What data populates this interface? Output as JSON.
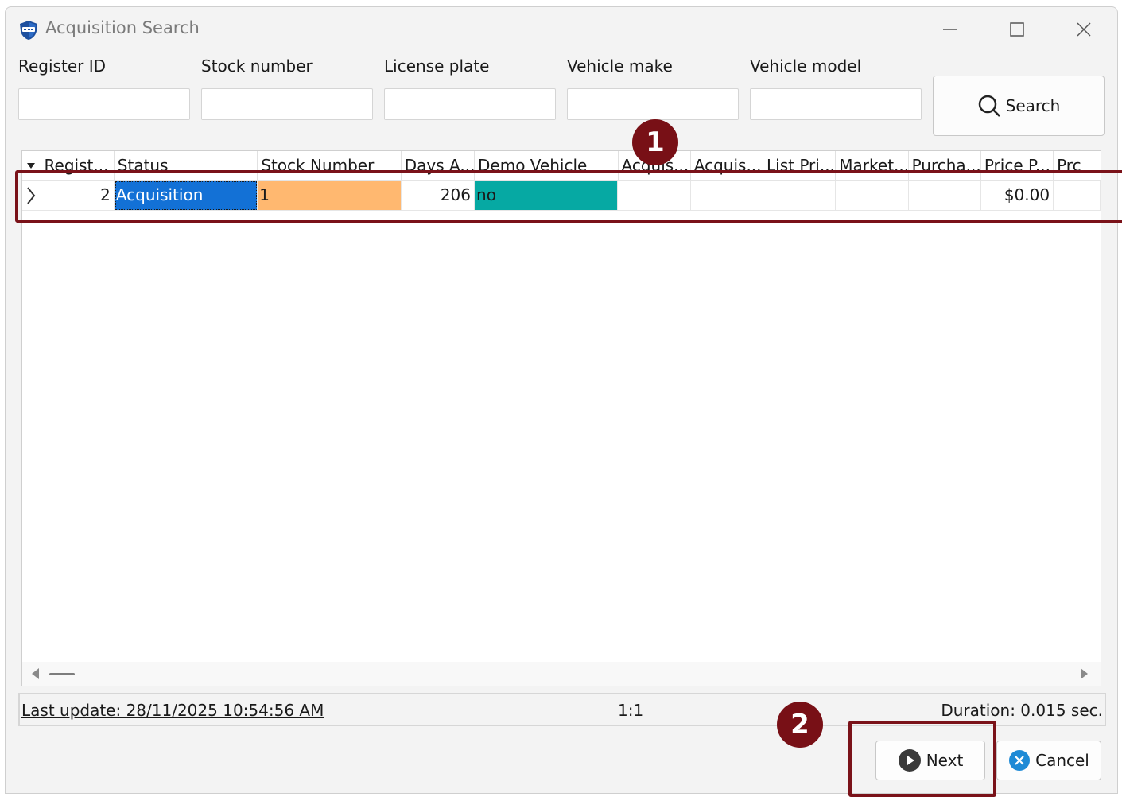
{
  "window": {
    "title": "Acquisition Search"
  },
  "filters": [
    {
      "label": "Register ID",
      "value": ""
    },
    {
      "label": "Stock number",
      "value": ""
    },
    {
      "label": "License plate",
      "value": ""
    },
    {
      "label": "Vehicle make",
      "value": ""
    },
    {
      "label": "Vehicle model",
      "value": ""
    }
  ],
  "search_label": "Search",
  "grid": {
    "columns": [
      "Regist...",
      "Status",
      "Stock Number",
      "Days A...",
      "Demo Vehicle",
      "Acquis...",
      "Acquis...",
      "List Pri...",
      "Market...",
      "Purcha...",
      "Price P...",
      "Prc"
    ],
    "rows": [
      {
        "register": "2",
        "status": "Acquisition",
        "stock": "1",
        "days": "206",
        "demo": "no",
        "acq1": "",
        "acq2": "",
        "list": "",
        "market": "",
        "purchase": "",
        "price": "$0.00",
        "prc": ""
      }
    ]
  },
  "status": {
    "last_update": "Last update: 28/11/2025 10:54:56 AM",
    "position": "1:1",
    "duration": "Duration: 0.015  sec."
  },
  "buttons": {
    "next": "Next",
    "cancel": "Cancel"
  },
  "callouts": [
    "1",
    "2"
  ],
  "colors": {
    "selected": "#1371d6",
    "stock": "#ffb870",
    "demo": "#06a9a3",
    "callout": "#781016"
  }
}
